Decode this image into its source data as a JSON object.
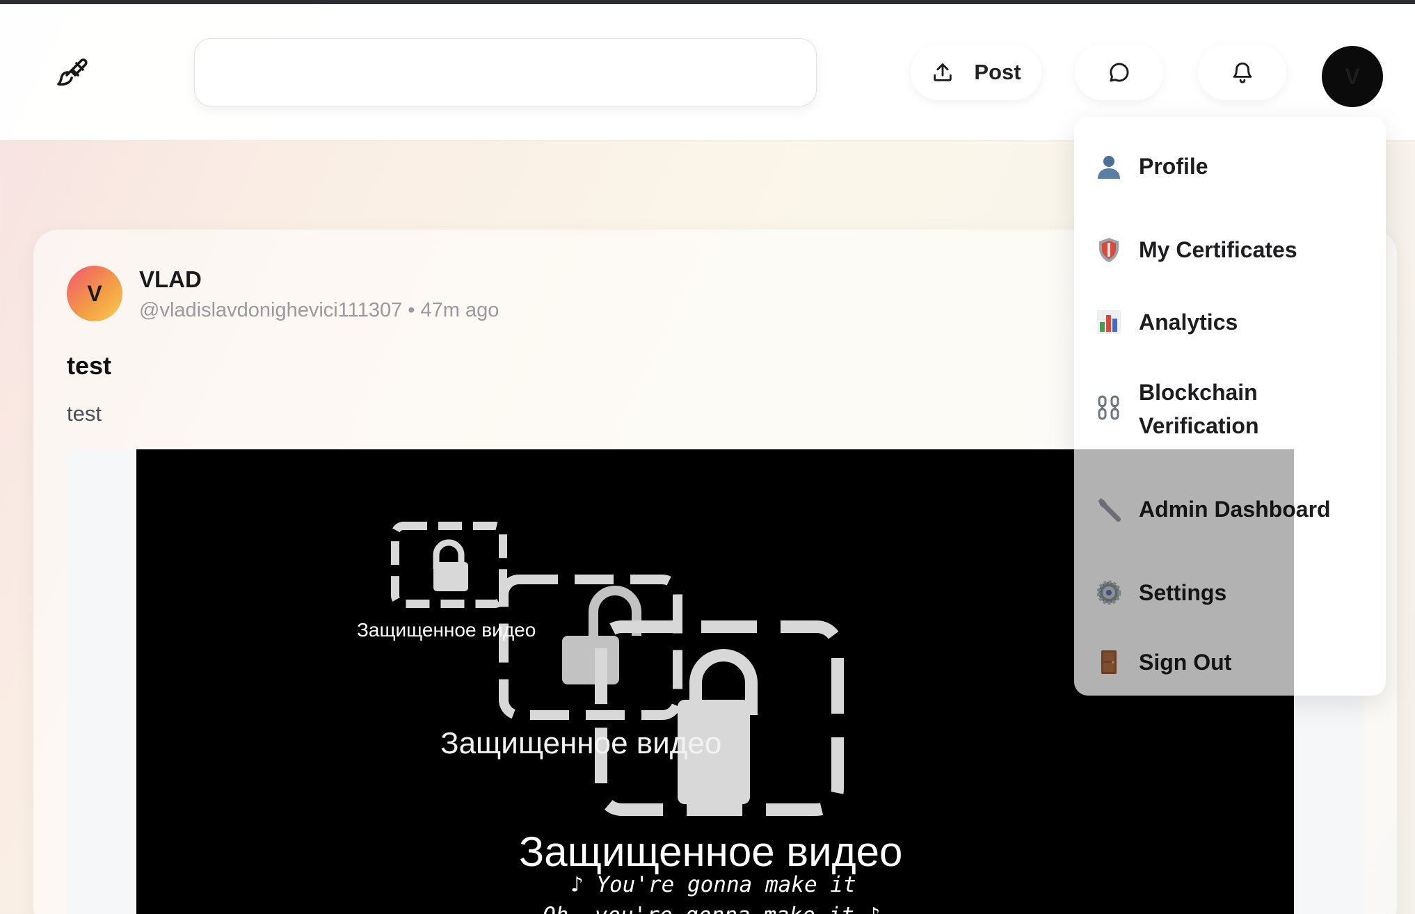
{
  "header": {
    "search": {
      "value": "",
      "placeholder": ""
    },
    "post_button_label": "Post",
    "avatar_initial": "V"
  },
  "post": {
    "author": {
      "initial": "V",
      "name": "VLAD",
      "handle": "@vladislavdonighevici111307",
      "separator": "•",
      "time": "47m ago"
    },
    "title": "test",
    "body": "test",
    "video": {
      "overlay_text_small": "Защищенное видео",
      "overlay_text_medium": "Защищенное видео",
      "overlay_text_large": "Защищенное видео",
      "caption_line1": "♪ You're gonna make it",
      "caption_line2": "Oh, you're gonna make it ♪"
    }
  },
  "user_menu": {
    "items": [
      {
        "label": "Profile",
        "icon": "bust-silhouette-icon"
      },
      {
        "label": "My Certificates",
        "icon": "shield-icon"
      },
      {
        "label": "Analytics",
        "icon": "bar-chart-icon"
      },
      {
        "label_line1": "Blockchain",
        "label_line2": "Verification",
        "icon": "chain-icon"
      },
      {
        "label": "Admin Dashboard",
        "icon": "wrench-icon"
      },
      {
        "label": "Settings",
        "icon": "gear-icon"
      },
      {
        "label": "Sign Out",
        "icon": "door-icon"
      }
    ]
  },
  "colors": {
    "avatar_gradient_start": "#f0566e",
    "avatar_gradient_end": "#f9cd52",
    "video_background": "#000000",
    "menu_background": "#ffffff"
  }
}
